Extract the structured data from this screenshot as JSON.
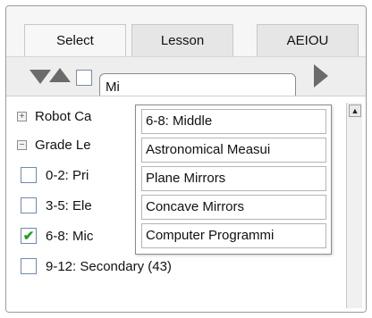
{
  "tabs": [
    {
      "label": "Select",
      "active": true
    },
    {
      "label": "Lesson",
      "active": false
    },
    {
      "label": "AEIOU",
      "active": false
    }
  ],
  "search": {
    "value": "Mi"
  },
  "tree": {
    "rows": [
      {
        "type": "group",
        "expander": "+",
        "label": "Robot Ca"
      },
      {
        "type": "group",
        "expander": "−",
        "label": "Grade Le"
      },
      {
        "type": "item",
        "checked": false,
        "label": "0-2: Pri"
      },
      {
        "type": "item",
        "checked": false,
        "label": "3-5: Ele"
      },
      {
        "type": "item",
        "checked": true,
        "label": "6-8: Mic"
      },
      {
        "type": "item",
        "checked": false,
        "label": "9-12: Secondary (43)"
      }
    ]
  },
  "dropdown": {
    "options": [
      "6-8: Middle",
      "Astronomical Measui",
      "Plane Mirrors",
      "Concave Mirrors",
      "Computer Programmi"
    ]
  },
  "scrollbar": {
    "up_arrow": "▲"
  },
  "icons": [
    "collapse-all-icon",
    "expand-all-icon",
    "select-all-checkbox",
    "go-arrow-icon"
  ]
}
